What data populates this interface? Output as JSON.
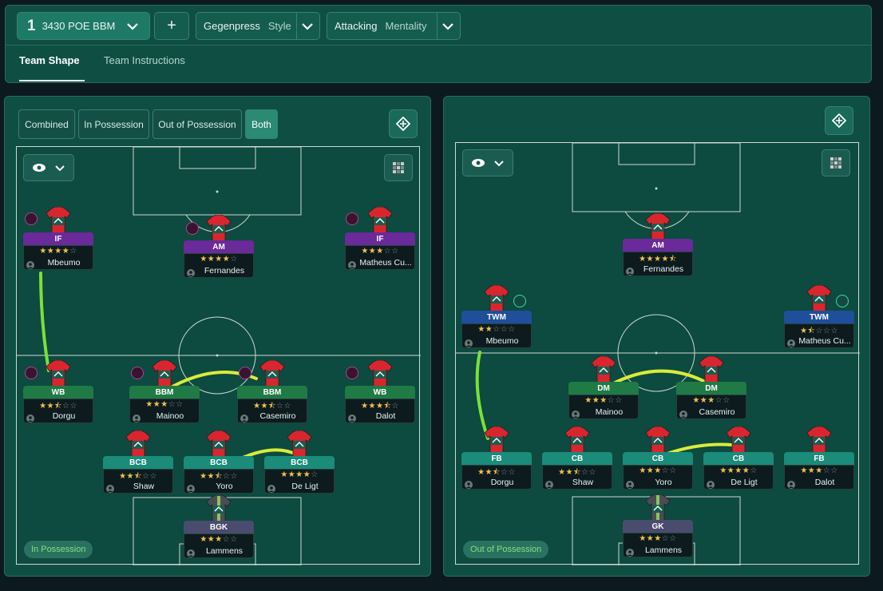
{
  "topbar": {
    "formation_num": "1",
    "formation_name": "3430 POE BBM",
    "add_label": "+",
    "pressing": {
      "value": "Gegenpress",
      "label": "Style"
    },
    "mentality": {
      "value": "Attacking",
      "label": "Mentality"
    },
    "tabs": [
      "Team Shape",
      "Team Instructions"
    ]
  },
  "left": {
    "segments": [
      "Combined",
      "In Possession",
      "Out of Possession",
      "Both"
    ],
    "active_segment": "Both",
    "phase_label": "In Possession",
    "players": [
      {
        "role": "IF",
        "name": "Mbeumo",
        "stars": 4.0,
        "role_color": "purple"
      },
      {
        "role": "AM",
        "name": "Fernandes",
        "stars": 4.0,
        "role_color": "purple"
      },
      {
        "role": "IF",
        "name": "Matheus Cu...",
        "stars": 3.0,
        "role_color": "purple"
      },
      {
        "role": "WB",
        "name": "Dorgu",
        "stars": 2.5,
        "role_color": "green"
      },
      {
        "role": "BBM",
        "name": "Mainoo",
        "stars": 3.0,
        "role_color": "green"
      },
      {
        "role": "BBM",
        "name": "Casemiro",
        "stars": 2.5,
        "role_color": "green"
      },
      {
        "role": "WB",
        "name": "Dalot",
        "stars": 3.5,
        "role_color": "green"
      },
      {
        "role": "BCB",
        "name": "Shaw",
        "stars": 2.5,
        "role_color": "teal"
      },
      {
        "role": "BCB",
        "name": "Yoro",
        "stars": 2.5,
        "role_color": "teal"
      },
      {
        "role": "BCB",
        "name": "De Ligt",
        "stars": 4.0,
        "role_color": "teal"
      },
      {
        "role": "BGK",
        "name": "Lammens",
        "stars": 3.0,
        "role_color": "slate"
      }
    ]
  },
  "right": {
    "phase_label": "Out of Possession",
    "players": [
      {
        "role": "AM",
        "name": "Fernandes",
        "stars": 4.5,
        "role_color": "purple"
      },
      {
        "role": "TWM",
        "name": "Mbeumo",
        "stars": 2.0,
        "role_color": "blue"
      },
      {
        "role": "TWM",
        "name": "Matheus Cu...",
        "stars": 1.5,
        "role_color": "blue"
      },
      {
        "role": "DM",
        "name": "Mainoo",
        "stars": 3.0,
        "role_color": "green"
      },
      {
        "role": "DM",
        "name": "Casemiro",
        "stars": 3.0,
        "role_color": "green"
      },
      {
        "role": "FB",
        "name": "Dorgu",
        "stars": 2.5,
        "role_color": "teal"
      },
      {
        "role": "CB",
        "name": "Shaw",
        "stars": 2.5,
        "role_color": "teal"
      },
      {
        "role": "CB",
        "name": "Yoro",
        "stars": 3.0,
        "role_color": "teal"
      },
      {
        "role": "CB",
        "name": "De Ligt",
        "stars": 4.0,
        "role_color": "teal"
      },
      {
        "role": "FB",
        "name": "Dalot",
        "stars": 3.0,
        "role_color": "teal"
      },
      {
        "role": "GK",
        "name": "Lammens",
        "stars": 3.0,
        "role_color": "slate"
      }
    ]
  },
  "colors": {
    "accent": "#1d7a67",
    "link_green": "#7be03a",
    "link_yellow": "#d9ec3a",
    "shirt": "#d9262e"
  }
}
